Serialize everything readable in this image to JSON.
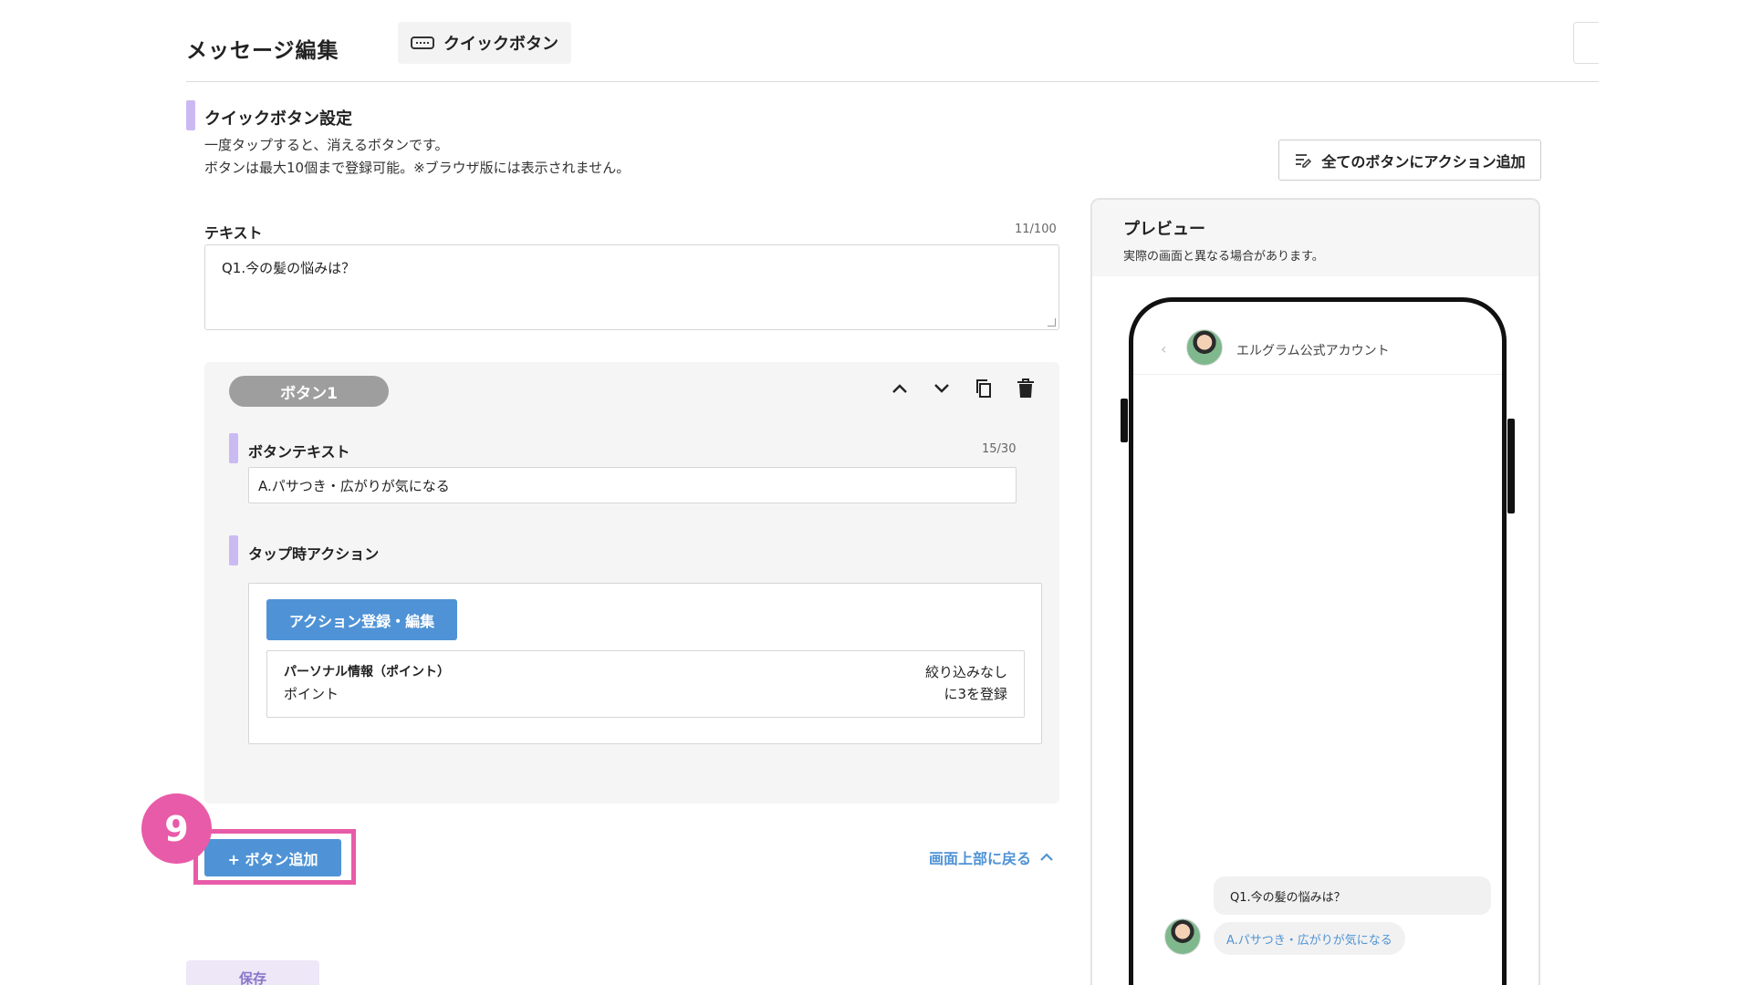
{
  "header": {
    "title": "メッセージ編集",
    "type_chip": "クイックボタン"
  },
  "section": {
    "title": "クイックボタン設定",
    "desc1": "一度タップすると、消えるボタンです。",
    "desc2": "ボタンは最大10個まで登録可能。※ブラウザ版には表示されません。",
    "add_all_actions_label": "全てのボタンにアクション追加"
  },
  "text_field": {
    "label": "テキスト",
    "counter": "11/100",
    "value": "Q1.今の髪の悩みは？"
  },
  "button_card": {
    "pill_label": "ボタン1",
    "button_text_label": "ボタンテキスト",
    "button_text_counter": "15/30",
    "button_text_value": "A.パサつき・広がりが気になる",
    "tap_action_label": "タップ時アクション",
    "action_edit_label": "アクション登録・編集",
    "action_item": {
      "title": "パーソナル情報（ポイント）",
      "subtitle": "ポイント",
      "right1": "絞り込みなし",
      "right2": "に3を登録"
    }
  },
  "add_button_label": "+ ボタン追加",
  "step_badge": "9",
  "back_to_top_label": "画面上部に戻る",
  "save_label": "保存",
  "preview": {
    "title": "プレビュー",
    "note": "実際の画面と異なる場合があります。",
    "account_name": "エルグラム公式アカウント",
    "message_text": "Q1.今の髪の悩みは？",
    "quick_reply": "A.パサつき・広がりが気になる"
  },
  "colors": {
    "accent_blue": "#4f93d6",
    "highlight_pink": "#e85ba8",
    "section_bar_lavender": "#cbb9f2"
  },
  "icons": [
    "keyboard-icon",
    "chevron-up-icon",
    "chevron-down-icon",
    "copy-icon",
    "trash-icon",
    "action-list-icon",
    "chevron-left-icon"
  ]
}
